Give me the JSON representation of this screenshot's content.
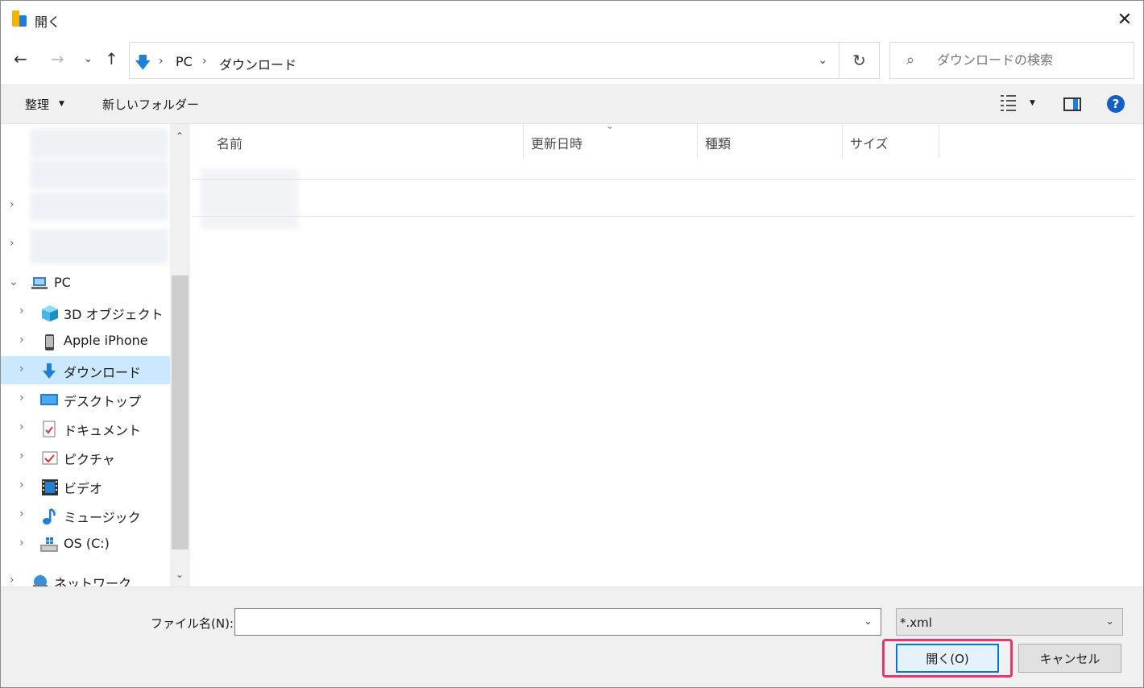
{
  "window": {
    "title": "開く",
    "close_glyph": "✕"
  },
  "nav": {
    "back_glyph": "←",
    "forward_glyph": "→",
    "recent_glyph": "⌄",
    "up_glyph": "↑",
    "address": {
      "crumbs": [
        "PC",
        "ダウンロード"
      ],
      "separator": "›",
      "dropdown_glyph": "⌄"
    },
    "refresh_glyph": "↻",
    "search": {
      "placeholder": "ダウンロードの検索",
      "icon_glyph": "⌕"
    }
  },
  "toolbar": {
    "organize_label": "整理",
    "caret_glyph": "▼",
    "new_folder_label": "新しいフォルダー",
    "help_glyph": "?"
  },
  "tree": {
    "expand_glyph": "›",
    "collapse_glyph": "⌄",
    "pc_label": "PC",
    "items": [
      {
        "label": "3D オブジェクト",
        "icon": "cube-icon"
      },
      {
        "label": "Apple iPhone",
        "icon": "phone-icon"
      },
      {
        "label": "ダウンロード",
        "icon": "download-icon",
        "selected": true
      },
      {
        "label": "デスクトップ",
        "icon": "desktop-icon"
      },
      {
        "label": "ドキュメント",
        "icon": "document-icon"
      },
      {
        "label": "ピクチャ",
        "icon": "picture-icon"
      },
      {
        "label": "ビデオ",
        "icon": "video-icon"
      },
      {
        "label": "ミュージック",
        "icon": "music-icon"
      },
      {
        "label": "OS (C:)",
        "icon": "drive-icon"
      }
    ],
    "network_label": "ネットワーク",
    "scroll_up_glyph": "⌃",
    "scroll_down_glyph": "⌄"
  },
  "filelist": {
    "columns": [
      "名前",
      "更新日時",
      "種類",
      "サイズ"
    ],
    "sort_glyph": "⌄"
  },
  "bottom": {
    "filename_label": "ファイル名(N):",
    "filename_value": "",
    "filename_caret": "⌄",
    "filter_value": "*.xml",
    "filter_caret": "⌄",
    "open_label": "開く(O)",
    "cancel_label": "キャンセル"
  },
  "colors": {
    "accent": "#0078d7",
    "selection": "#cce8ff",
    "highlight": "#e8356d"
  }
}
